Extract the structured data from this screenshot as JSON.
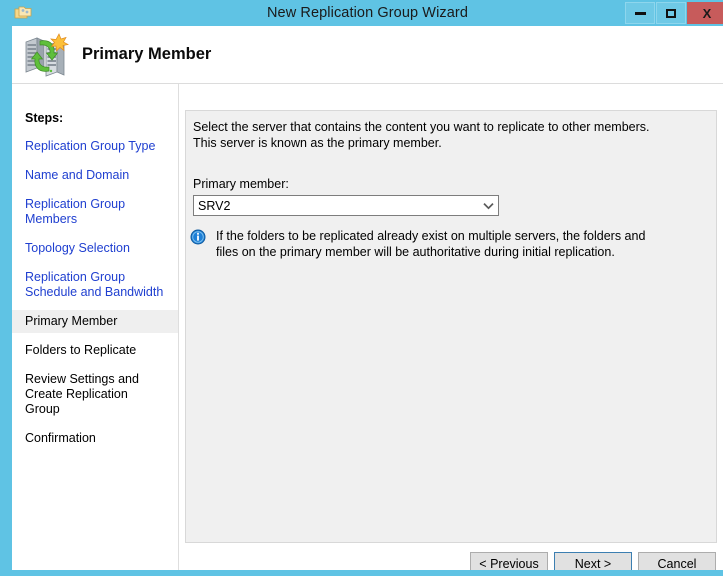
{
  "window": {
    "title": "New Replication Group Wizard",
    "icon": "dfs-folders-icon",
    "controls": {
      "minimize": "minimize-icon",
      "maximize": "maximize-icon",
      "close": "X"
    },
    "accent_color": "#5FC3E4",
    "close_color": "#C75B5B"
  },
  "banner": {
    "title": "Primary Member",
    "icon": "replication-servers-icon"
  },
  "sidebar": {
    "heading": "Steps:",
    "items": [
      {
        "label": "Replication Group Type",
        "state": "link"
      },
      {
        "label": "Name and Domain",
        "state": "link"
      },
      {
        "label": "Replication Group Members",
        "state": "link"
      },
      {
        "label": "Topology Selection",
        "state": "link"
      },
      {
        "label": "Replication Group Schedule and Bandwidth",
        "state": "link"
      },
      {
        "label": "Primary Member",
        "state": "current"
      },
      {
        "label": "Folders to Replicate",
        "state": "plain"
      },
      {
        "label": "Review Settings and Create Replication Group",
        "state": "plain"
      },
      {
        "label": "Confirmation",
        "state": "plain"
      }
    ],
    "link_color": "#1f3fd0",
    "current_highlight": "#efefef"
  },
  "content": {
    "intro_line1": "Select the server that contains the content you want to replicate to other members.",
    "intro_line2": "This server is known as the primary member.",
    "combo_label": "Primary member:",
    "combo_value": "SRV2",
    "combo_arrow_icon": "chevron-down-icon",
    "note_icon": "info-icon",
    "note_line1": "If the folders to be replicated already exist on multiple servers, the folders and",
    "note_line2": "files on the primary member will be authoritative during initial replication."
  },
  "buttons": {
    "previous": "< Previous",
    "next": "Next >",
    "cancel": "Cancel"
  }
}
